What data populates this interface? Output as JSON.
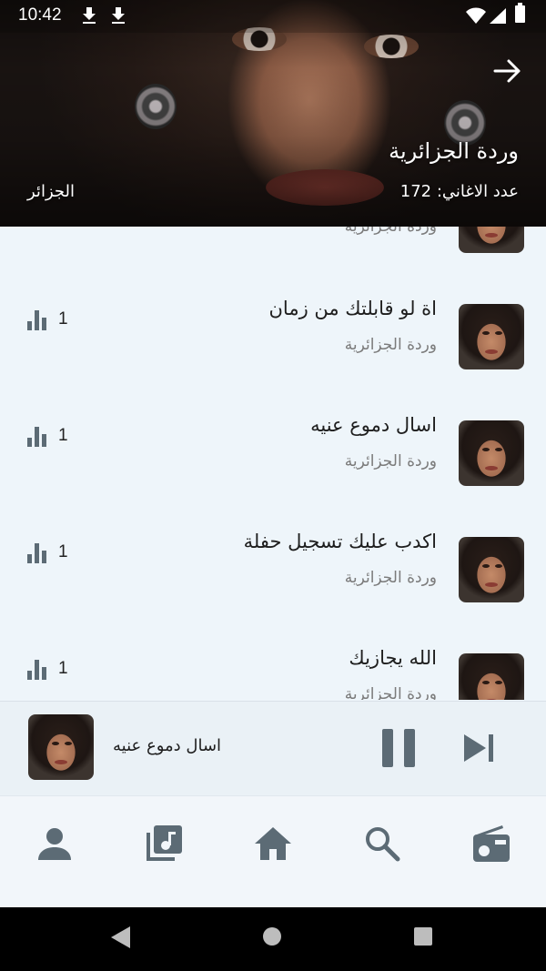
{
  "status_bar": {
    "time": "10:42"
  },
  "header": {
    "artist_name": "وردة الجزائرية",
    "songs_count": "عدد الاغاني: 172",
    "country": "الجزائر"
  },
  "songs": [
    {
      "title": "",
      "artist": "وردة الجزائرية",
      "plays": ""
    },
    {
      "title": "اة لو قابلتك من زمان",
      "artist": "وردة الجزائرية",
      "plays": "1"
    },
    {
      "title": "اسال دموع عنيه",
      "artist": "وردة الجزائرية",
      "plays": "1"
    },
    {
      "title": "اكدب عليك تسجيل حفلة",
      "artist": "وردة الجزائرية",
      "plays": "1"
    },
    {
      "title": "الله يجازيك",
      "artist": "وردة الجزائرية",
      "plays": "1"
    }
  ],
  "player": {
    "now_playing": "اسال دموع عنيه"
  },
  "icons": {
    "back": "arrow-right-icon",
    "plays": "bar-chart-icon",
    "pause": "pause-icon",
    "next": "skip-next-icon",
    "nav": [
      "person-icon",
      "library-music-icon",
      "home-icon",
      "search-icon",
      "radio-icon"
    ]
  },
  "colors": {
    "icon_gray": "#5c6b75",
    "background": "#eef5fa"
  }
}
